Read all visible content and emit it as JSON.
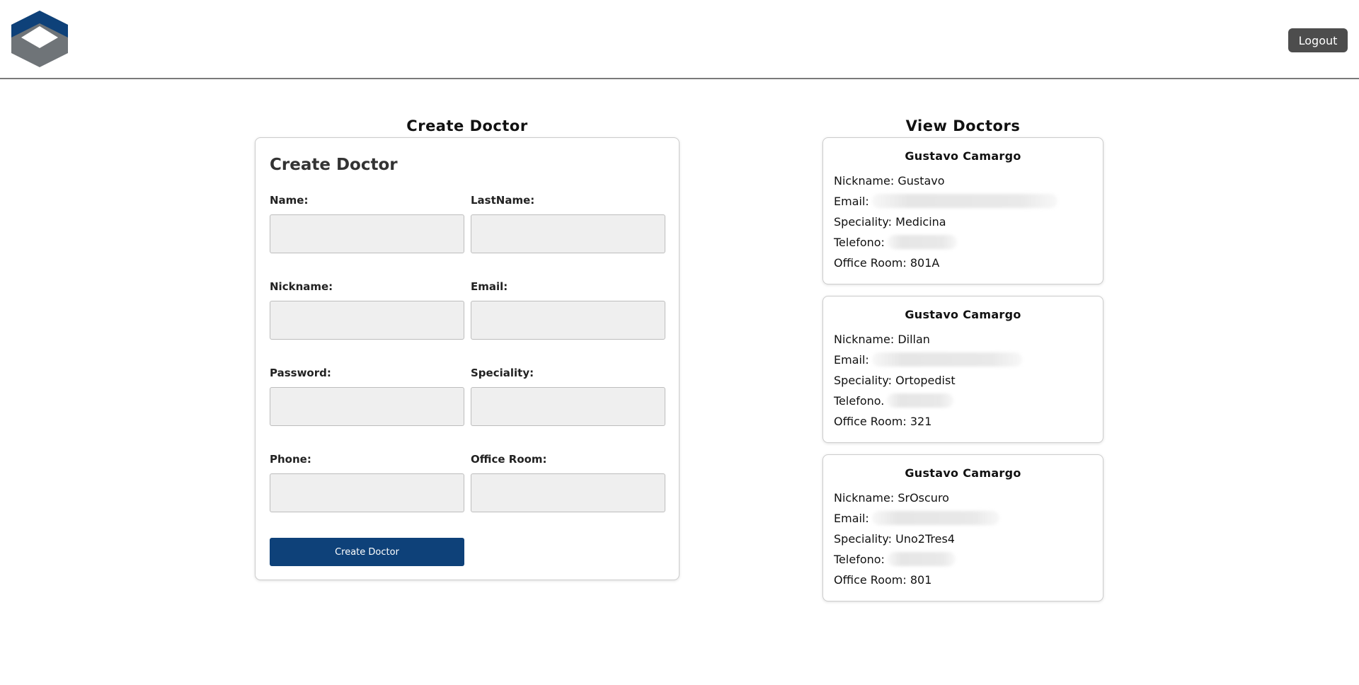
{
  "header": {
    "logo_icon": "cube-logo-icon",
    "logout_label": "Logout"
  },
  "create_section": {
    "title": "Create Doctor",
    "form_heading": "Create Doctor",
    "fields": {
      "name": "Name:",
      "lastname": "LastName:",
      "nickname": "Nickname:",
      "email": "Email:",
      "password": "Password:",
      "speciality": "Speciality:",
      "phone": "Phone:",
      "office_room": "Office Room:"
    },
    "submit_label": "Create Doctor"
  },
  "view_section": {
    "title": "View Doctors",
    "labels": {
      "nickname": "Nickname:",
      "email": "Email:",
      "speciality": "Speciality:",
      "telefono": "Telefono:",
      "telefono_alt": "Telefono.",
      "office_room": "Office Room:"
    },
    "doctors": [
      {
        "name": "Gustavo Camargo",
        "nickname": "Gustavo",
        "speciality": "Medicina",
        "office_room": "801A"
      },
      {
        "name": "Gustavo Camargo",
        "nickname": "Dillan",
        "speciality": "Ortopedist",
        "office_room": "321"
      },
      {
        "name": "Gustavo Camargo",
        "nickname": "SrOscuro",
        "speciality": "Uno2Tres4",
        "office_room": "801"
      }
    ]
  },
  "colors": {
    "brand_blue": "#0e4179",
    "logo_gray": "#6f7478",
    "logout_bg": "#4d4d4d",
    "input_bg": "#efefef"
  }
}
